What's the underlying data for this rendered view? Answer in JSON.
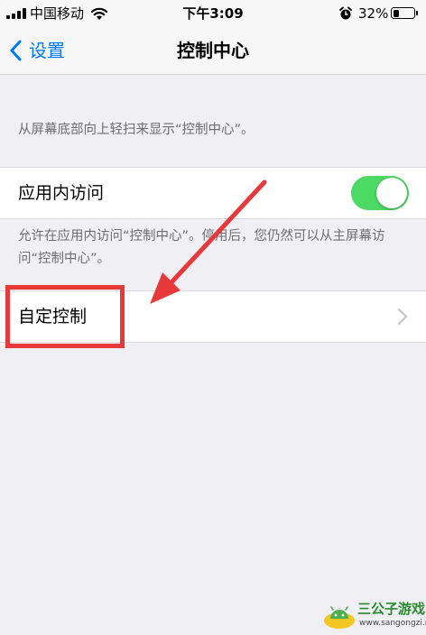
{
  "status_bar": {
    "carrier": "中国移动",
    "time": "下午3:09",
    "battery_percent": "32%",
    "battery_level": 0.32,
    "icons": [
      "signal-icon",
      "wifi-icon",
      "alarm-icon",
      "battery-icon"
    ]
  },
  "nav": {
    "back_label": "设置",
    "title": "控制中心"
  },
  "section1": {
    "footer": "从屏幕底部向上轻扫来显示“控制中心”。"
  },
  "access_row": {
    "label": "应用内访问",
    "toggle_on": true,
    "toggle_color": "#4cd964"
  },
  "section2": {
    "footer": "允许在应用内访问“控制中心”。停用后，您仍然可以从主屏幕访问“控制中心”。"
  },
  "customize_row": {
    "label": "自定控制"
  },
  "annotation": {
    "color": "#e73939"
  },
  "watermark": {
    "name": "三公子游戏网",
    "url": "www.sangongzi.net"
  },
  "colors": {
    "accent": "#007aff",
    "background": "#efeff4",
    "secondary_text": "#6d6d72"
  }
}
